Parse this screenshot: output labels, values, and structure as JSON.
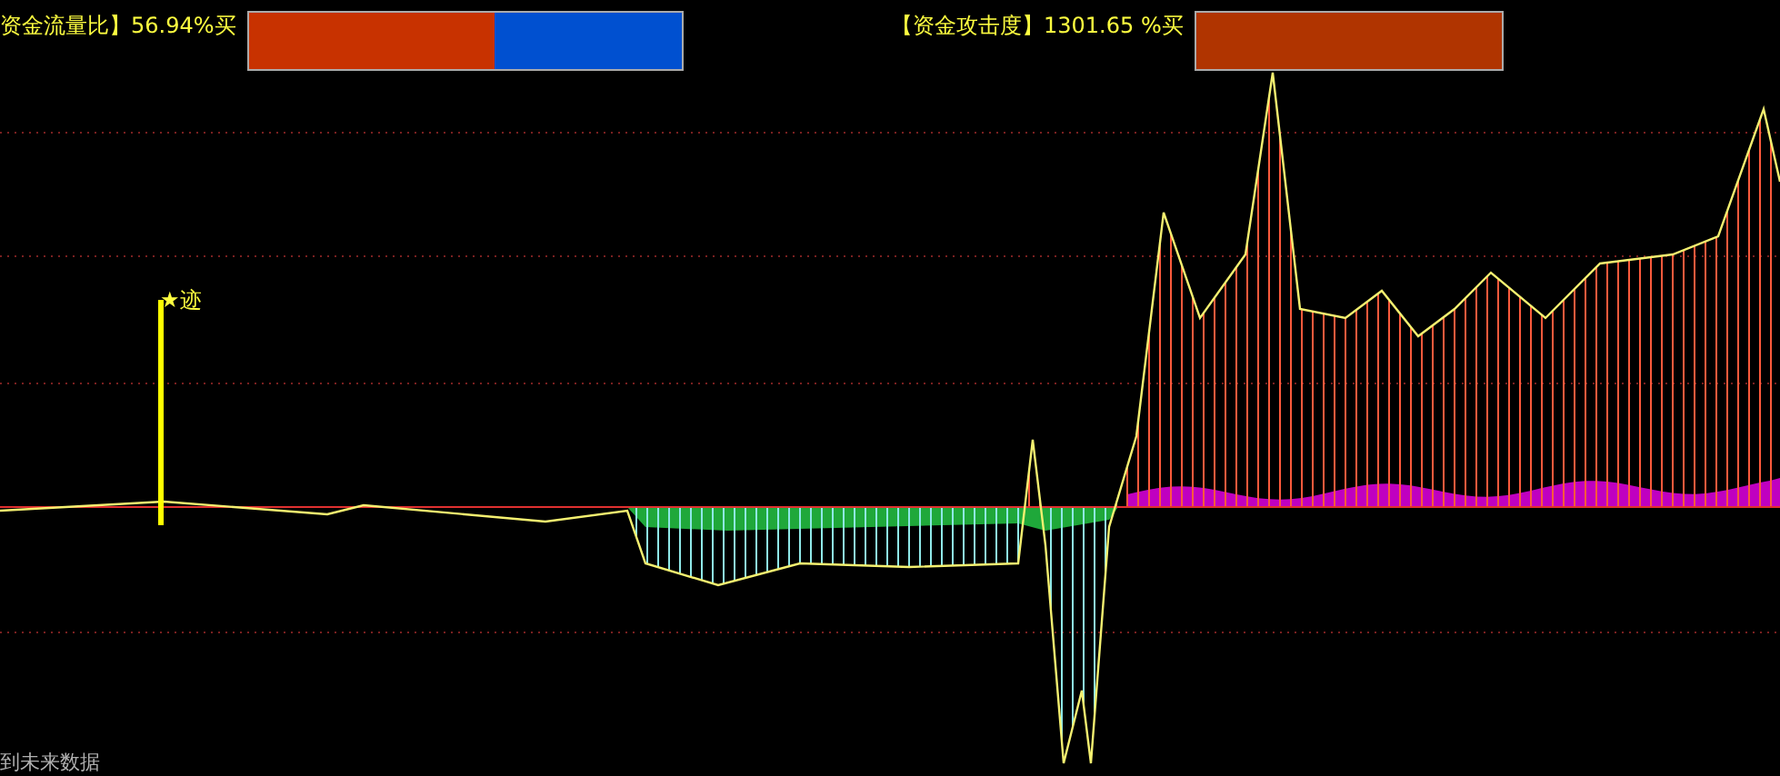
{
  "indicators": [
    {
      "label": "资金流量比】56.94%买",
      "bars": [
        {
          "kind": "split",
          "level": 0.5694
        }
      ]
    },
    {
      "label": "【资金攻击度】1301.65 %买",
      "bars": [
        {
          "kind": "full",
          "level": 1
        }
      ]
    }
  ],
  "chart": {
    "marker": "★迹",
    "footer": "到未来数据"
  }
}
